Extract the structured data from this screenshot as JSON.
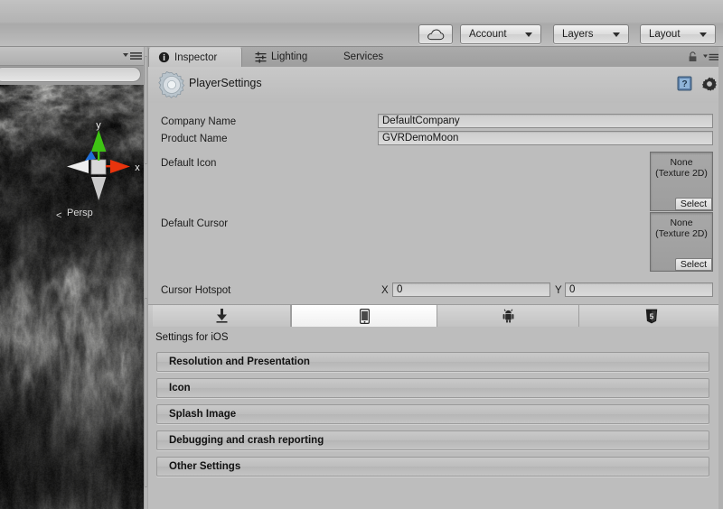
{
  "toolbar": {
    "cloud_button": {
      "name": "cloud-button",
      "icon": "cloud-icon"
    },
    "account": {
      "label": "Account",
      "icon": "chevron-down-icon"
    },
    "layers": {
      "label": "Layers",
      "icon": "chevron-down-icon"
    },
    "layout": {
      "label": "Layout",
      "icon": "chevron-down-icon"
    }
  },
  "scene_view": {
    "gizmo": {
      "axis_y": "y",
      "axis_x": "x",
      "colors": {
        "y": "#3ec313",
        "x": "#e8340d",
        "z": "#1f6fd8"
      }
    },
    "projection_label": "Persp",
    "projection_arrow": "<"
  },
  "inspector": {
    "tabs": [
      {
        "label": "Inspector",
        "icon": "info-circle-icon",
        "active": true
      },
      {
        "label": "Lighting",
        "icon": "sliders-icon",
        "active": false
      },
      {
        "label": "Services",
        "icon": "",
        "active": false
      }
    ],
    "lock_icon": "lock-icon",
    "menu_icon": "hamburger-menu-icon",
    "title": "PlayerSettings",
    "title_icon": "gear-icon",
    "help_icon": "help-book-icon",
    "settings_icon": "gear-icon",
    "properties": {
      "company_name": {
        "label": "Company Name",
        "value": "DefaultCompany"
      },
      "product_name": {
        "label": "Product Name",
        "value": "GVRDemoMoon"
      },
      "default_icon": {
        "label": "Default Icon",
        "slot_line1": "None",
        "slot_line2": "(Texture 2D)",
        "select_label": "Select"
      },
      "default_cursor": {
        "label": "Default Cursor",
        "slot_line1": "None",
        "slot_line2": "(Texture 2D)",
        "select_label": "Select"
      },
      "cursor_hotspot": {
        "label": "Cursor Hotspot",
        "x_label": "X",
        "x_value": "0",
        "y_label": "Y",
        "y_value": "0"
      }
    },
    "platform_tabs": [
      {
        "name": "standalone",
        "icon": "download-arrow-icon",
        "selected": false
      },
      {
        "name": "ios",
        "icon": "phone-icon",
        "selected": true
      },
      {
        "name": "android",
        "icon": "android-robot-icon",
        "selected": false
      },
      {
        "name": "webgl",
        "icon": "html5-shield-icon",
        "selected": false
      }
    ],
    "settings_header": "Settings for iOS",
    "sections": [
      {
        "label": "Resolution and Presentation"
      },
      {
        "label": "Icon"
      },
      {
        "label": "Splash Image"
      },
      {
        "label": "Debugging and crash reporting"
      },
      {
        "label": "Other Settings"
      }
    ]
  },
  "colors": {
    "chrome": "#bdbdbd",
    "toolbar": "#b3b3b3",
    "tab_active": "#cacaca",
    "field_bg": "#d4d4d4",
    "text": "#1c1c1c"
  }
}
